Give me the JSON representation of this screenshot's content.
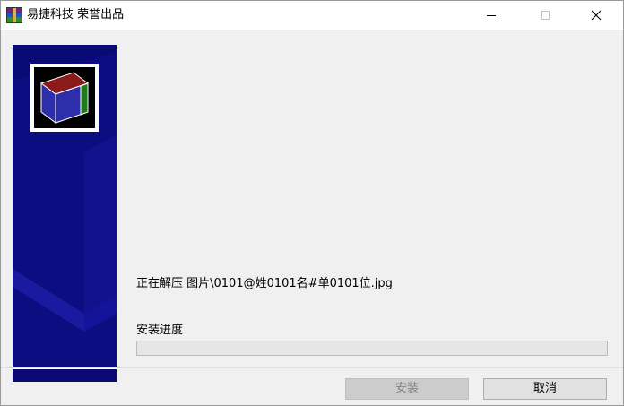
{
  "window": {
    "title": "易捷科技 荣誉出品"
  },
  "title_buttons": {
    "minimize_icon": "minimize-icon",
    "maximize_icon": "maximize-icon",
    "close_icon": "close-icon"
  },
  "sidebar": {
    "logo_icon": "winrar-box-icon",
    "colors": {
      "background": "#0a0a75",
      "box_top": "#8b1a1a",
      "box_front": "#2d2fa8",
      "box_side": "#1e7a1e"
    }
  },
  "main": {
    "status_text": "正在解压 图片\\0101@姓0101名#单0101位.jpg",
    "progress_label": "安装进度",
    "progress_fraction": 0.0
  },
  "buttons": {
    "install_label": "安装",
    "cancel_label": "取消"
  }
}
